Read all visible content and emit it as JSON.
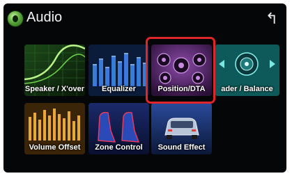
{
  "header": {
    "title": "Audio",
    "app_icon": "audio-app-icon",
    "back_icon": "return-arrow-icon",
    "back_glyph": "↰"
  },
  "tiles": [
    {
      "label": "Speaker / X'over"
    },
    {
      "label": "Equalizer"
    },
    {
      "label": "Position/DTA"
    },
    {
      "label": "ader / Balance"
    },
    {
      "label": "Volume Offset"
    },
    {
      "label": "Zone Control"
    },
    {
      "label": "Sound Effect"
    }
  ],
  "colors": {
    "background": "#050608",
    "highlight": "#e0262a",
    "text": "#ffffff"
  }
}
